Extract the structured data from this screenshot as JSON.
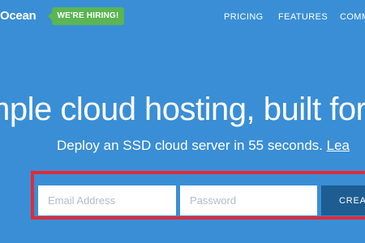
{
  "header": {
    "logo_text": "Ocean",
    "hiring_badge": "WE'RE HIRING!",
    "nav": [
      {
        "label": "PRICING"
      },
      {
        "label": "FEATURES"
      },
      {
        "label": "COMM"
      }
    ]
  },
  "hero": {
    "headline": "mple cloud hosting, built for d",
    "subhead_text": "Deploy an SSD cloud server in 55 seconds. ",
    "subhead_link": "Lea"
  },
  "signup": {
    "email_placeholder": "Email Address",
    "password_placeholder": "Password",
    "submit_label": "CREAT"
  },
  "colors": {
    "background": "#3a8ed5",
    "badge": "#5ab552",
    "highlight_border": "#e02b36",
    "submit_button": "#1d5d92"
  }
}
